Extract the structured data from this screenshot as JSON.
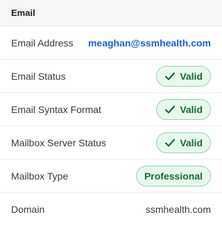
{
  "section_title": "Email",
  "rows": [
    {
      "label": "Email Address",
      "value": "meaghan@ssmhealth.com",
      "kind": "link"
    },
    {
      "label": "Email Status",
      "value": "Valid",
      "kind": "badge-check"
    },
    {
      "label": "Email Syntax Format",
      "value": "Valid",
      "kind": "badge-check"
    },
    {
      "label": "Mailbox Server Status",
      "value": "Valid",
      "kind": "badge-check"
    },
    {
      "label": "Mailbox Type",
      "value": "Professional",
      "kind": "badge"
    },
    {
      "label": "Domain",
      "value": "ssmhealth.com",
      "kind": "text"
    }
  ],
  "colors": {
    "link": "#1c5fd6",
    "badge_bg": "#e9f8ee",
    "badge_border": "#8fd6a4",
    "badge_text": "#146c33"
  },
  "icons": {
    "valid": "check-icon"
  }
}
